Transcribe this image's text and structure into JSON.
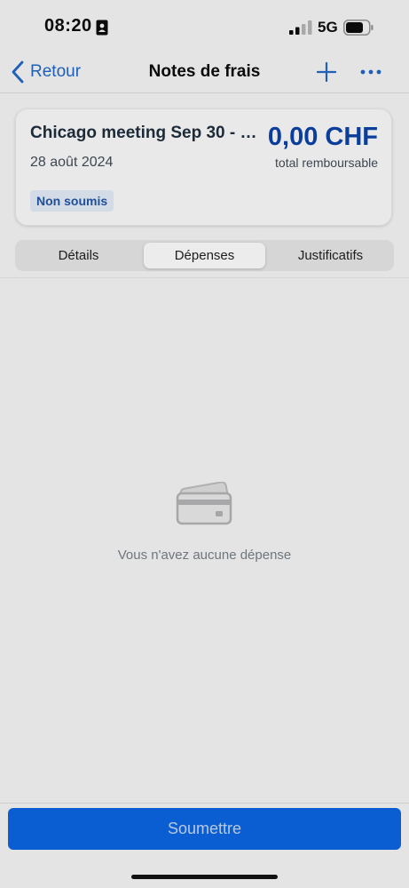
{
  "status_bar": {
    "time": "08:20",
    "network": "5G",
    "icons": [
      "id-card-icon",
      "signal-icon",
      "battery-icon"
    ]
  },
  "nav": {
    "back_label": "Retour",
    "title": "Notes de frais",
    "icons": [
      "chevron-left-icon",
      "plus-icon",
      "more-icon"
    ]
  },
  "report": {
    "title": "Chicago meeting Sep 30 - O…",
    "date": "28 août 2024",
    "amount": "0,00 CHF",
    "amount_caption": "total remboursable",
    "status": "Non soumis"
  },
  "tabs": [
    {
      "label": "Détails",
      "selected": false
    },
    {
      "label": "Dépenses",
      "selected": true
    },
    {
      "label": "Justificatifs",
      "selected": false
    }
  ],
  "empty_state": {
    "icon": "credit-card-icon",
    "message": "Vous n'avez aucune dépense"
  },
  "footer": {
    "submit_label": "Soumettre"
  },
  "colors": {
    "accent": "#0b5ed1",
    "amount": "#0b3e9a",
    "background": "#e4e4e4"
  }
}
